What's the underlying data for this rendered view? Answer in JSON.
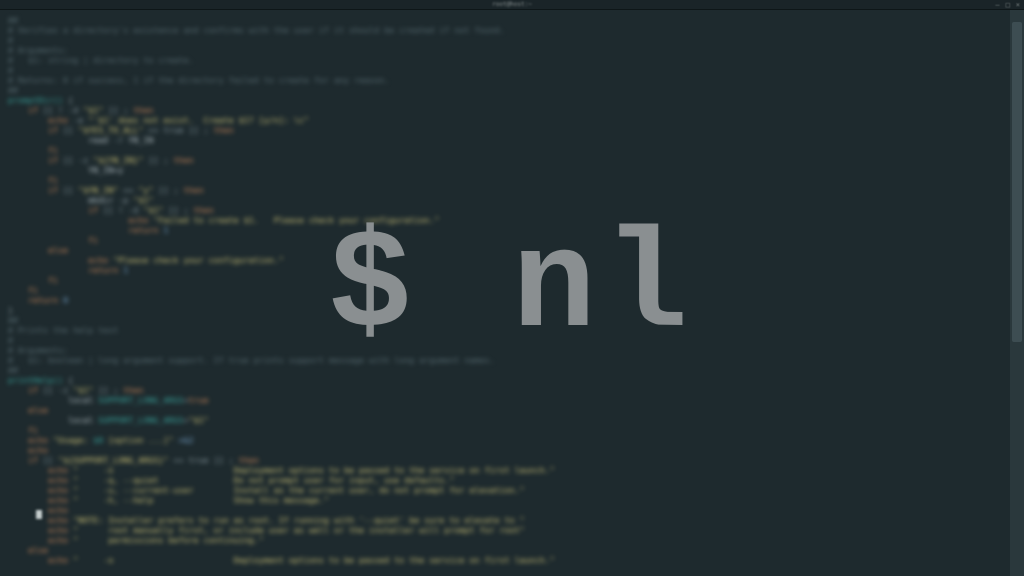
{
  "window": {
    "title": "root@host:~",
    "controls": {
      "min": "–",
      "max": "□",
      "close": "×"
    }
  },
  "overlay": {
    "text": "$ nl"
  },
  "code": {
    "lines": [
      [
        [
          "c-comment",
          "##"
        ]
      ],
      [
        [
          "c-comment",
          "# Verifies a directory's existence and confirms with the user if it should be created if not found."
        ]
      ],
      [
        [
          "c-comment",
          "#"
        ]
      ],
      [
        [
          "c-comment",
          "# Arguments:"
        ]
      ],
      [
        [
          "c-comment",
          "#   $1: string | directory to create."
        ]
      ],
      [
        [
          "c-comment",
          "#"
        ]
      ],
      [
        [
          "c-comment",
          "# Returns: 0 if success, 1 if the directory failed to create for any reason."
        ]
      ],
      [
        [
          "c-comment",
          "##"
        ]
      ],
      [
        [
          "c-func",
          "promptDir()"
        ],
        [
          "c-punc",
          " {"
        ]
      ],
      [
        [
          "c-key",
          "    if "
        ],
        [
          "c-punc",
          "[[ ! -d "
        ],
        [
          "c-str",
          "\"$1\""
        ],
        [
          "c-punc",
          " ]] ; "
        ],
        [
          "c-key",
          "then"
        ]
      ],
      [
        [
          "c-echo",
          "        echo"
        ],
        [
          "c-punc",
          " -e "
        ],
        [
          "c-str",
          "\"'$1' does not exist.  Create $1? [y/n]: \\c\""
        ]
      ],
      [
        [
          "c-key",
          "        if "
        ],
        [
          "c-punc",
          "[[ "
        ],
        [
          "c-str",
          "\"$YES_TO_ALL\""
        ],
        [
          "c-punc",
          " == true ]] ; "
        ],
        [
          "c-key",
          "then"
        ]
      ],
      [
        [
          "c-var",
          "                read"
        ],
        [
          "c-punc",
          " -r "
        ],
        [
          "c-var",
          "YN_IN"
        ]
      ],
      [
        [
          "c-key",
          "        fi"
        ]
      ],
      [
        [
          "c-key",
          "        if "
        ],
        [
          "c-punc",
          "[[ -z "
        ],
        [
          "c-str",
          "\"${YN_IN}\""
        ],
        [
          "c-punc",
          " ]] ; "
        ],
        [
          "c-key",
          "then"
        ]
      ],
      [
        [
          "c-var",
          "                YN_IN=y"
        ]
      ],
      [
        [
          "c-key",
          "        fi"
        ]
      ],
      [
        [
          "c-key",
          "        if "
        ],
        [
          "c-punc",
          "[[ "
        ],
        [
          "c-str",
          "\"$YN_IN\""
        ],
        [
          "c-punc",
          " == "
        ],
        [
          "c-str",
          "\"y\""
        ],
        [
          "c-punc",
          " ]] ; "
        ],
        [
          "c-key",
          "then"
        ]
      ],
      [
        [
          "c-var",
          "                mkdir"
        ],
        [
          "c-punc",
          " -p "
        ],
        [
          "c-str",
          "\"$1\""
        ]
      ],
      [
        [
          "c-key",
          "                if "
        ],
        [
          "c-punc",
          "[[ ! -d "
        ],
        [
          "c-str",
          "\"$1\""
        ],
        [
          "c-punc",
          " ]] ; "
        ],
        [
          "c-key",
          "then"
        ]
      ],
      [
        [
          "c-echo",
          "                        echo "
        ],
        [
          "c-str",
          "\"Failed to create $1.   Please check your configuration.\""
        ]
      ],
      [
        [
          "c-key",
          "                        return "
        ],
        [
          "c-num",
          "1"
        ]
      ],
      [
        [
          "c-key",
          "                fi"
        ]
      ],
      [
        [
          "c-key",
          "        else"
        ]
      ],
      [
        [
          "c-echo",
          "                echo "
        ],
        [
          "c-str",
          "\"Please check your configuration.\""
        ]
      ],
      [
        [
          "c-key",
          "                return "
        ],
        [
          "c-num",
          "1"
        ]
      ],
      [
        [
          "c-key",
          "        fi"
        ]
      ],
      [
        [
          "c-key",
          "    fi"
        ]
      ],
      [
        [
          "c-key",
          "    return "
        ],
        [
          "c-num",
          "0"
        ]
      ],
      [
        [
          "c-punc",
          "}"
        ]
      ],
      [
        [
          "",
          ""
        ]
      ],
      [
        [
          "c-comment",
          "##"
        ]
      ],
      [
        [
          "c-comment",
          "# Prints the help text"
        ]
      ],
      [
        [
          "c-comment",
          "#"
        ]
      ],
      [
        [
          "c-comment",
          "# Arguments:"
        ]
      ],
      [
        [
          "c-comment",
          "#   $1: boolean | long argument support. If true prints support message with long argument names."
        ]
      ],
      [
        [
          "c-comment",
          "##"
        ]
      ],
      [
        [
          "c-func",
          "printHelp()"
        ],
        [
          "c-punc",
          " {"
        ]
      ],
      [
        [
          "c-key",
          "    if "
        ],
        [
          "c-punc",
          "[[ -z "
        ],
        [
          "c-str",
          "\"$1\""
        ],
        [
          "c-punc",
          " ]] ; "
        ],
        [
          "c-key",
          "then"
        ]
      ],
      [
        [
          "c-var",
          "            local "
        ],
        [
          "c-func",
          "SUPPORT_LONG_ARGS"
        ],
        [
          "c-punc",
          "="
        ],
        [
          "c-key",
          "true"
        ]
      ],
      [
        [
          "c-key",
          "    else"
        ]
      ],
      [
        [
          "c-var",
          "            local "
        ],
        [
          "c-func",
          "SUPPORT_LONG_ARGS"
        ],
        [
          "c-punc",
          "="
        ],
        [
          "c-str",
          "\"$1\""
        ]
      ],
      [
        [
          "c-key",
          "    fi"
        ]
      ],
      [
        [
          "",
          ""
        ]
      ],
      [
        [
          "c-echo",
          "    echo "
        ],
        [
          "c-str",
          "\"Usage: "
        ],
        [
          "c-func",
          "$0"
        ],
        [
          "c-str",
          " [option ...]\" "
        ],
        [
          "c-num",
          ">&2"
        ]
      ],
      [
        [
          "c-echo",
          "    echo"
        ]
      ],
      [
        [
          "c-key",
          "    if "
        ],
        [
          "c-punc",
          "[[ "
        ],
        [
          "c-str",
          "\"${SUPPORT_LONG_ARGS}\""
        ],
        [
          "c-punc",
          " == true ]] ; "
        ],
        [
          "c-key",
          "then"
        ]
      ],
      [
        [
          "c-echo",
          "        echo "
        ],
        [
          "c-str",
          "\"     -o                        Deployment options to be passed to the service on first launch.\""
        ]
      ],
      [
        [
          "c-echo",
          "        echo "
        ],
        [
          "c-str",
          "\"     -q, --quiet               Do not prompt user for input, use defaults.\""
        ]
      ],
      [
        [
          "c-echo",
          "        echo "
        ],
        [
          "c-str",
          "\"     -u, --current-user        Install as the current user, do not prompt for elevation.\""
        ]
      ],
      [
        [
          "c-echo",
          "        echo "
        ],
        [
          "c-str",
          "\"     -h, --help                Show this message.\""
        ]
      ],
      [
        [
          "c-echo",
          "        echo"
        ]
      ],
      [
        [
          "c-echo",
          "        echo "
        ],
        [
          "c-str",
          "\"NOTE: Installer prefers to run as root. If running with '--quiet' be sure to elevate to \""
        ]
      ],
      [
        [
          "c-echo",
          "        echo "
        ],
        [
          "c-str",
          "\"      root manually first, or include user as well or the installer will prompt for root\""
        ]
      ],
      [
        [
          "c-echo",
          "        echo "
        ],
        [
          "c-str",
          "\"      permissions before continuing.\""
        ]
      ],
      [
        [
          "c-key",
          "    else"
        ]
      ],
      [
        [
          "c-echo",
          "        echo "
        ],
        [
          "c-str",
          "\"     -o                        Deployment options to be passed to the service on first launch.\""
        ]
      ]
    ]
  }
}
